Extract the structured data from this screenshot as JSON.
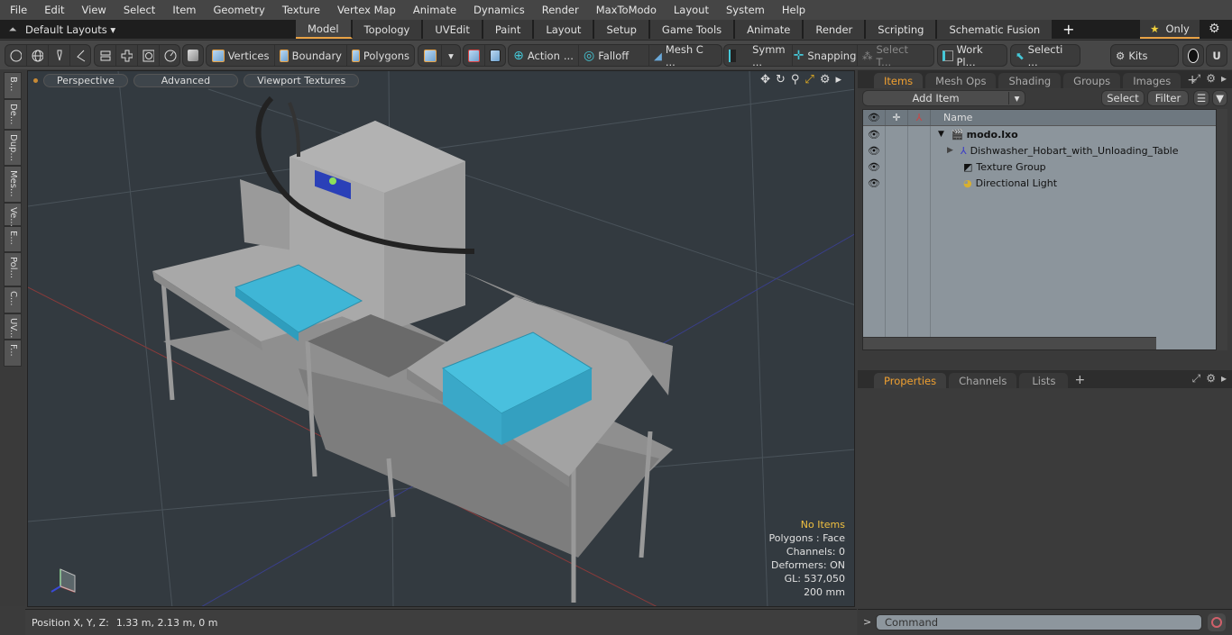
{
  "menu": [
    "File",
    "Edit",
    "View",
    "Select",
    "Item",
    "Geometry",
    "Texture",
    "Vertex Map",
    "Animate",
    "Dynamics",
    "Render",
    "MaxToModo",
    "Layout",
    "System",
    "Help"
  ],
  "layout": {
    "selector": "Default Layouts ▾",
    "tabs": [
      "Model",
      "Topology",
      "UVEdit",
      "Paint",
      "Layout",
      "Setup",
      "Game Tools",
      "Animate",
      "Render",
      "Scripting",
      "Schematic Fusion"
    ],
    "active_tab": "Model",
    "only_label": "Only"
  },
  "toolbar": {
    "vertices": "Vertices",
    "boundary": "Boundary",
    "polygons": "Polygons",
    "action": "Action",
    "falloff": "Falloff",
    "mesh": "Mesh C ...",
    "symm": "Symm ...",
    "snapping": "Snapping",
    "select_t": "Select T...",
    "workplane": "Work Pl...",
    "selection": "Selecti ...",
    "kits": "Kits",
    "ellipsis": "..."
  },
  "left_tabs": [
    "B...",
    "De...",
    "Dup...",
    "Mes...",
    "Ve...",
    "E...",
    "Pol...",
    "C...",
    "UV...",
    "F..."
  ],
  "viewport": {
    "buttons": [
      "Perspective",
      "Advanced",
      "Viewport Textures"
    ],
    "info": {
      "selection": "No Items",
      "polygons": "Polygons : Face",
      "channels": "Channels: 0",
      "deformers": "Deformers: ON",
      "gl": "GL: 537,050",
      "grid": "200 mm"
    }
  },
  "status": {
    "label": "Position X, Y, Z:",
    "value": "1.33 m, 2.13 m, 0 m"
  },
  "items_panel": {
    "tabs": [
      "Items",
      "Mesh Ops",
      "Shading",
      "Groups",
      "Images"
    ],
    "active_tab": "Items",
    "add_item": "Add Item",
    "select": "Select",
    "filter": "Filter",
    "name_header": "Name",
    "tree": [
      {
        "name": "modo.lxo",
        "icon": "scene-icon",
        "level": 0
      },
      {
        "name": "Dishwasher_Hobart_with_Unloading_Table",
        "icon": "locator-icon",
        "level": 1
      },
      {
        "name": "Texture Group",
        "icon": "texture-group-icon",
        "level": 1
      },
      {
        "name": "Directional Light",
        "icon": "light-icon",
        "level": 1
      }
    ]
  },
  "properties_panel": {
    "tabs": [
      "Properties",
      "Channels",
      "Lists"
    ],
    "active_tab": "Properties"
  },
  "command": {
    "prompt": ">",
    "placeholder": "Command"
  },
  "colors": {
    "accent": "#e8a245",
    "viewport_bg": "#333a40",
    "rack": "#3fb6d6",
    "info_highlight": "#f0c040"
  }
}
